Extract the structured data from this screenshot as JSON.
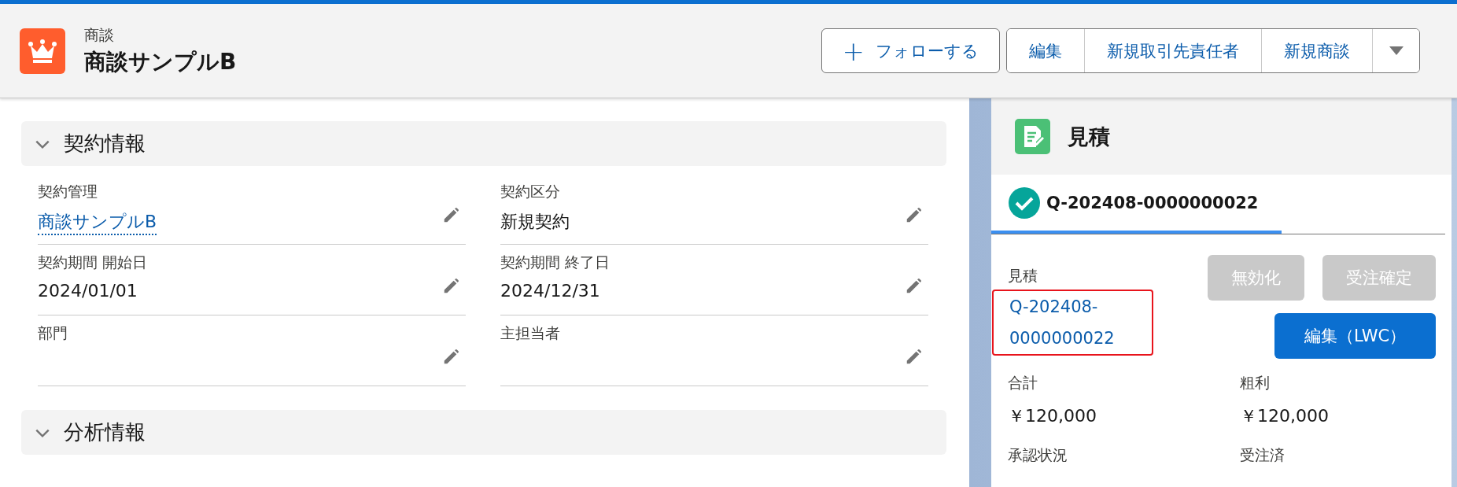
{
  "header": {
    "object_label": "商談",
    "title": "商談サンプルB",
    "follow_button": {
      "icon": "+",
      "label": "フォローする"
    },
    "actions": [
      "編集",
      "新規取引先責任者",
      "新規商談"
    ]
  },
  "sections": [
    {
      "title": "契約情報",
      "expanded": true,
      "fields": [
        {
          "label": "契約管理",
          "kind": "link",
          "value": "商談サンプルB"
        },
        {
          "label": "契約区分",
          "kind": "text",
          "value": "新規契約"
        },
        {
          "label": "契約期間 開始日",
          "kind": "text",
          "value": "2024/01/01"
        },
        {
          "label": "契約期間 終了日",
          "kind": "text",
          "value": "2024/12/31"
        },
        {
          "label": "部門"
        },
        {
          "label": "主担当者"
        }
      ]
    },
    {
      "title": "分析情報",
      "expanded": true
    }
  ],
  "quote_card": {
    "title": "見積",
    "tabs": [
      {
        "label": "Q-202408-0000000022",
        "selected": true
      }
    ],
    "quote_label": "見積",
    "quote_link": "Q-202408-0000000022",
    "quote_highlighted": true,
    "buttons": [
      {
        "label": "無効化",
        "disabled": true
      },
      {
        "label": "受注確定",
        "disabled": true
      },
      {
        "label": "編集（LWC）",
        "disabled": false
      }
    ],
    "fields": [
      {
        "label": "合計",
        "value": "￥120,000"
      },
      {
        "label": "粗利",
        "value": "￥120,000"
      },
      {
        "label": "承認状況"
      },
      {
        "label": "受注済"
      }
    ]
  }
}
